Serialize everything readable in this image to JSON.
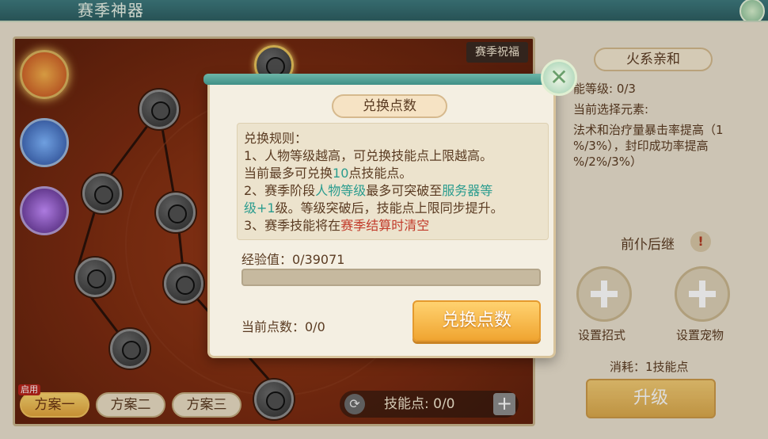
{
  "header": {
    "title": "赛季神器"
  },
  "tree": {
    "blessing_label": "赛季祝福",
    "tabs": [
      "方案一",
      "方案二",
      "方案三"
    ],
    "active_tab_badge": "启用",
    "skill_points_label": "技能点: 0/0"
  },
  "right_panel": {
    "element_tag": "火系亲和",
    "skill_level": "能等级: 0/3",
    "selected_element": "当前选择元素:",
    "desc_line1": "法术和治疗量暴击率提高（1",
    "desc_line2": "%/3%），封印成功率提高",
    "desc_line3": "%/2%/3%）",
    "successor_title": "前仆后继",
    "info_icon": "!",
    "slot_left_label": "设置招式",
    "slot_right_label": "设置宠物",
    "consume": "消耗：1技能点",
    "upgrade_label": "升级"
  },
  "modal": {
    "title": "兑换点数",
    "rules_heading": "兑换规则：",
    "rule1_a": "1、人物等级越高，可兑换技能点上限越高。",
    "rule1_b_prefix": "当前最多可兑换",
    "rule1_b_num": "10",
    "rule1_b_suffix": "点技能点。",
    "rule2_a": "2、赛季阶段",
    "rule2_level": "人物等级",
    "rule2_b": "最多可突破至",
    "rule2_server": "服务器等",
    "rule2_server2": "级+1",
    "rule2_c": "级。等级突破后，技能点上限同步提升。",
    "rule3_a": "3、赛季技能将在",
    "rule3_red": "赛季结算时清空",
    "exp_label": "经验值：0/39071",
    "exp_progress": 0,
    "current_points": "当前点数：0/0",
    "exchange_button": "兑换点数",
    "close_icon": "✕"
  },
  "colors": {
    "teal": "#2a9c8e",
    "red": "#c23a2a",
    "button_orange": "#f0a531"
  }
}
